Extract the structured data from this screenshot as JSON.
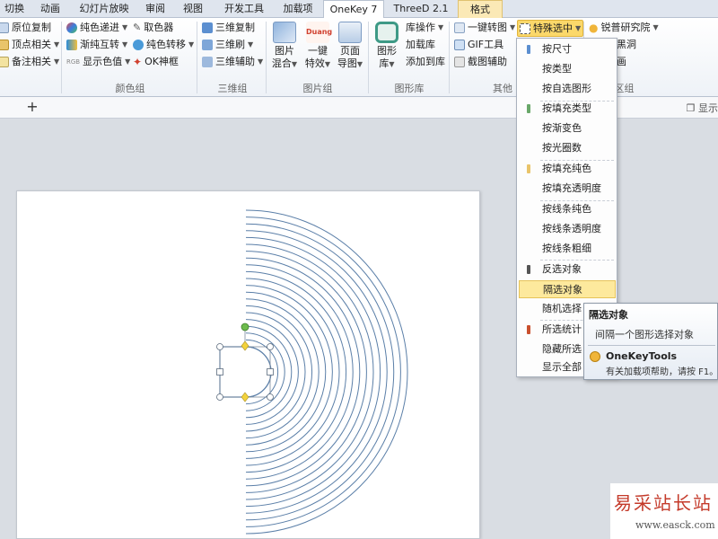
{
  "tabs": [
    "切换",
    "动画",
    "幻灯片放映",
    "审阅",
    "视图",
    "开发工具",
    "加载项",
    "OneKey 7",
    "ThreeD 2.1",
    "格式"
  ],
  "active_tab": "OneKey 7",
  "ribbon": {
    "group0": {
      "items": [
        "原位复制",
        "顶点相关",
        "备注相关"
      ]
    },
    "color_group": {
      "label": "颜色组",
      "items": [
        "纯色递进",
        "渐纯互转",
        "显示色值",
        "取色器",
        "纯色转移",
        "OK神框"
      ],
      "rgb_badge": "RGB"
    },
    "threed_group": {
      "label": "三维组",
      "items": [
        "三维复制",
        "三维刷",
        "三维辅助"
      ]
    },
    "picture_group": {
      "label": "图片组",
      "mix": [
        "图片",
        "混合"
      ],
      "effect": [
        "一键",
        "特效"
      ],
      "effect_badge": "Duang",
      "page": [
        "页面",
        "导图"
      ]
    },
    "library_group": {
      "label": "图形库",
      "lib_button": [
        "图形",
        "库"
      ],
      "items": [
        "库操作",
        "加载库",
        "添加到库"
      ]
    },
    "other_group": {
      "label": "其他",
      "items": [
        "一键转图",
        "GIF工具",
        "截图辅助"
      ],
      "special_select": "特殊选中"
    },
    "ruipu_group": {
      "label": "社区组",
      "items": [
        "锐普研究院",
        "看黑洞",
        "动画"
      ]
    }
  },
  "subbar": {
    "show": "显示"
  },
  "menu": {
    "items": [
      "按尺寸",
      "按类型",
      "按自选图形",
      "按填充类型",
      "按渐变色",
      "按光圈数",
      "按填充纯色",
      "按填充透明度",
      "按线条纯色",
      "按线条透明度",
      "按线条粗细",
      "反选对象",
      "隔选对象",
      "随机选择",
      "所选统计",
      "隐藏所选",
      "显示全部"
    ],
    "selected": "隔选对象"
  },
  "tooltip": {
    "title": "隔选对象",
    "description": "间隔一个图形选择对象",
    "brand": "OneKeyTools",
    "help": "有关加载项帮助，请按 F1。"
  },
  "watermark": {
    "name": "易采站长站",
    "url": "www.easck.com"
  },
  "colors": {
    "arc_stroke": "#5b7fa8",
    "handle_green": "#6dbb4c",
    "handle_yellow": "#f2d23d",
    "menu_highlight": "#fde99d",
    "watermark_red": "#c43a2a"
  }
}
